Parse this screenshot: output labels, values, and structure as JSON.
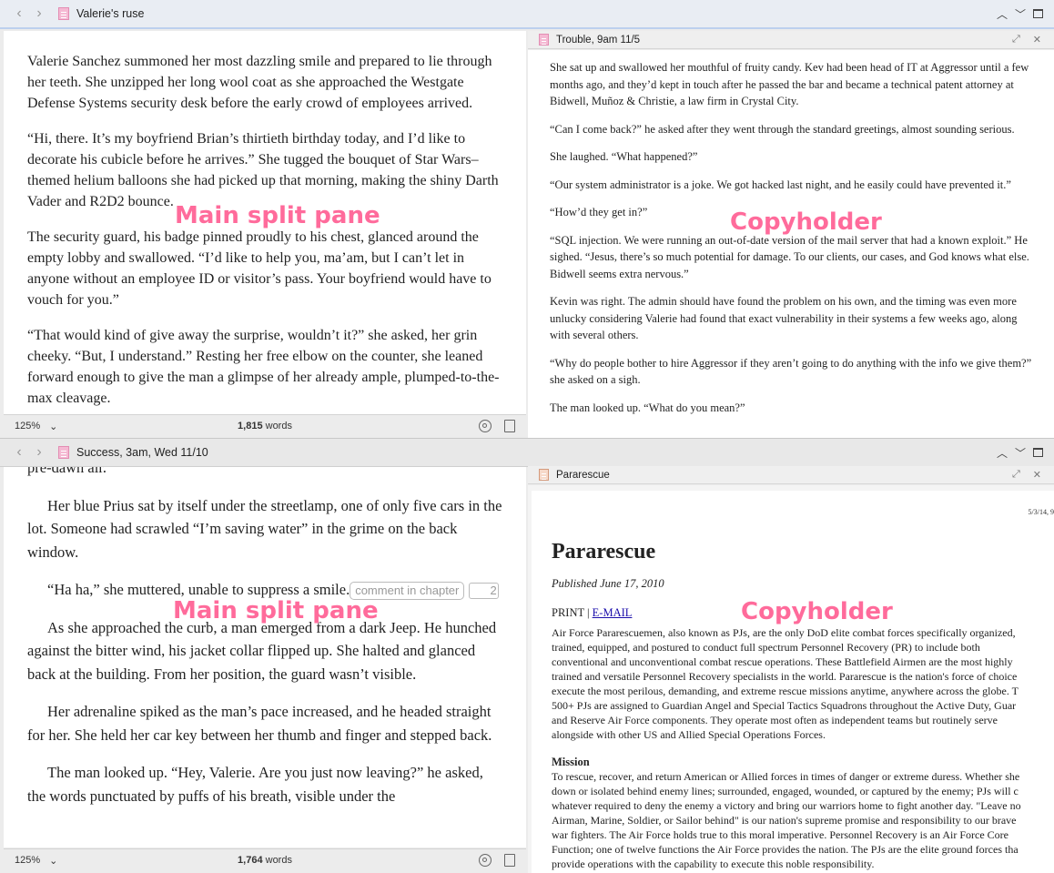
{
  "top": {
    "title": "Valerie's ruse",
    "editor": {
      "paragraphs": [
        "Valerie Sanchez summoned her most dazzling smile and prepared to lie through her teeth. She unzipped her long wool coat as she approached the Westgate Defense Systems security desk before the early crowd of employees arrived.",
        "“Hi, there. It’s my boyfriend Brian’s thirtieth birthday today, and I’d like to decorate his cubicle before he arrives.” She tugged the bouquet of Star Wars–themed helium balloons she had picked up that morning, making the shiny Darth Vader and R2D2 bounce.",
        "The security guard, his badge pinned proudly to his chest, glanced around the empty lobby and swallowed. “I’d like to help you, ma’am, but I can’t let in anyone without an employee ID or visitor’s pass. Your boyfriend would have to vouch for you.”",
        "“That would kind of give away the surprise, wouldn’t it?” she asked, her grin cheeky. “But, I understand.” Resting her free elbow on the counter, she leaned forward enough to give the man a glimpse of her already ample, plumped-to-the-max cleavage."
      ]
    },
    "footer": {
      "zoom": "125%",
      "words_count": "1,815",
      "words_label": "words"
    },
    "copyholder": {
      "title": "Trouble, 9am 11/5",
      "paragraphs": [
        "She sat up and swallowed her mouthful of fruity candy. Kev had been head of IT at Aggressor until a few months ago, and they’d kept in touch after he passed the bar and became a technical patent attorney at Bidwell, Muñoz & Christie, a law firm in Crystal City.",
        "“Can I come back?” he asked after they went through the standard greetings, almost sounding serious.",
        "She laughed. “What happened?”",
        "“Our system administrator is a joke. We got hacked last night, and he easily could have prevented it.”",
        "“How’d they get in?”",
        "“SQL injection. We were running an out-of-date version of the mail server that had a known exploit.” He sighed. “Jesus, there’s so much potential for damage. To our clients, our cases, and God knows what else. Bidwell seems extra nervous.”",
        "Kevin was right. The admin should have found the problem on his own, and the timing was even more unlucky considering Valerie had found that exact vulnerability in their systems a few weeks ago, along with several others.",
        "“Why do people bother to hire Aggressor if they aren’t going to do anything with the info we give them?” she asked on a sigh.",
        "The man looked up. “What do you mean?”"
      ]
    }
  },
  "bottom": {
    "title": "Success, 3am, Wed 11/10",
    "editor": {
      "partial_top": "pre-dawn air.",
      "p1": "Her blue Prius sat by itself under the streetlamp, one of only five cars in the lot. Someone had scrawled “I’m saving water” in the grime on the back window.",
      "p2": "“Ha ha,” she muttered, unable to suppress a smile.",
      "comment": "comment in chapter",
      "comment_end": "2",
      "p3": "As she approached the curb, a man emerged from a dark Jeep. He hunched against the bitter wind, his jacket collar flipped up. She halted and glanced back at the building. From her position, the guard wasn’t visible.",
      "p4": "Her adrenaline spiked as the man’s pace increased, and he headed straight for her. She held her car key between her thumb and finger and stepped back.",
      "p5": "The man looked up. “Hey, Valerie. Are you just now leaving?” he asked, the words punctuated by puffs of his breath, visible under the"
    },
    "footer": {
      "zoom": "125%",
      "words_count": "1,764",
      "words_label": "words"
    },
    "copyholder": {
      "title": "Pararescue",
      "date_stamp": "5/3/14, 9",
      "heading": "Pararescue",
      "published": "Published June 17, 2010",
      "print_label": "PRINT",
      "separator": "|",
      "email_label": "E-MAIL",
      "body_lines": [
        "Air Force Pararescuemen, also known as PJs, are the only DoD elite combat forces specifically organized,",
        "trained, equipped, and postured to conduct full spectrum Personnel Recovery (PR) to include both",
        "conventional and unconventional combat rescue operations. These Battlefield Airmen are the most highly",
        "trained and versatile Personnel Recovery specialists in the world. Pararescue is the nation's force of choice",
        "execute the most perilous, demanding, and extreme rescue missions anytime, anywhere across the globe. T",
        "500+ PJs are assigned to Guardian Angel and Special Tactics Squadrons throughout the Active Duty, Guar",
        "and Reserve Air Force components. They operate most often as independent teams but routinely serve",
        "alongside with other US and Allied Special Operations Forces."
      ],
      "mission_heading": "Mission",
      "mission_lines": [
        "To rescue, recover, and return American or Allied forces in times of danger or extreme duress. Whether she",
        "down or isolated behind enemy lines; surrounded, engaged, wounded, or captured by the enemy; PJs will c",
        "whatever required to deny the enemy a victory and bring our warriors home to fight another day. \"Leave no",
        "Airman, Marine, Soldier, or Sailor behind\" is our nation's supreme promise and responsibility to our brave",
        "war fighters. The Air Force holds true to this moral imperative. Personnel Recovery is an Air Force Core",
        "Function; one of twelve functions the Air Force provides the nation. The PJs are the elite ground forces tha",
        "provide operations with the capability to execute this noble responsibility."
      ]
    }
  },
  "annotations": {
    "main_split_top": "Main split pane",
    "copyholder_top": "Copyholder",
    "main_split_bottom": "Main split pane",
    "copyholder_bottom": "Copyholder"
  }
}
